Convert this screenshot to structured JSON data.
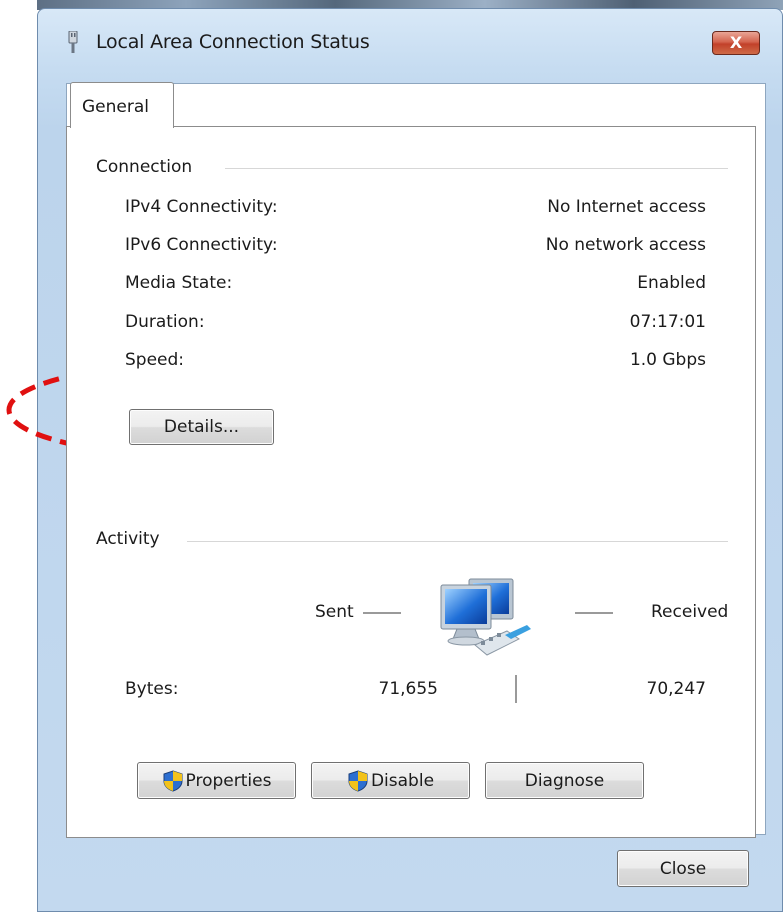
{
  "window": {
    "title": "Local Area Connection Status",
    "close_glyph": "X",
    "icon": "network-adapter-icon"
  },
  "tabs": [
    {
      "label": "General",
      "selected": true
    }
  ],
  "connection": {
    "group_label": "Connection",
    "rows": [
      {
        "label": "IPv4 Connectivity:",
        "value": "No Internet access"
      },
      {
        "label": "IPv6 Connectivity:",
        "value": "No network access"
      },
      {
        "label": "Media State:",
        "value": "Enabled"
      },
      {
        "label": "Duration:",
        "value": "07:17:01"
      },
      {
        "label": "Speed:",
        "value": "1.0 Gbps"
      }
    ],
    "details_label": "Details..."
  },
  "activity": {
    "group_label": "Activity",
    "sent_label": "Sent",
    "received_label": "Received",
    "bytes_label": "Bytes:",
    "bytes_sent": "71,655",
    "bytes_received": "70,247",
    "icon": "network-computers-icon"
  },
  "actions": {
    "properties_label": "Properties",
    "disable_label": "Disable",
    "diagnose_label": "Diagnose",
    "shield_icon": "uac-shield-icon"
  },
  "footer": {
    "close_label": "Close"
  },
  "annotation": {
    "color": "#e01010",
    "shape": "dashed-ellipse"
  },
  "colors": {
    "frame": "#c6dcf1",
    "close_button": "#c2412a"
  }
}
